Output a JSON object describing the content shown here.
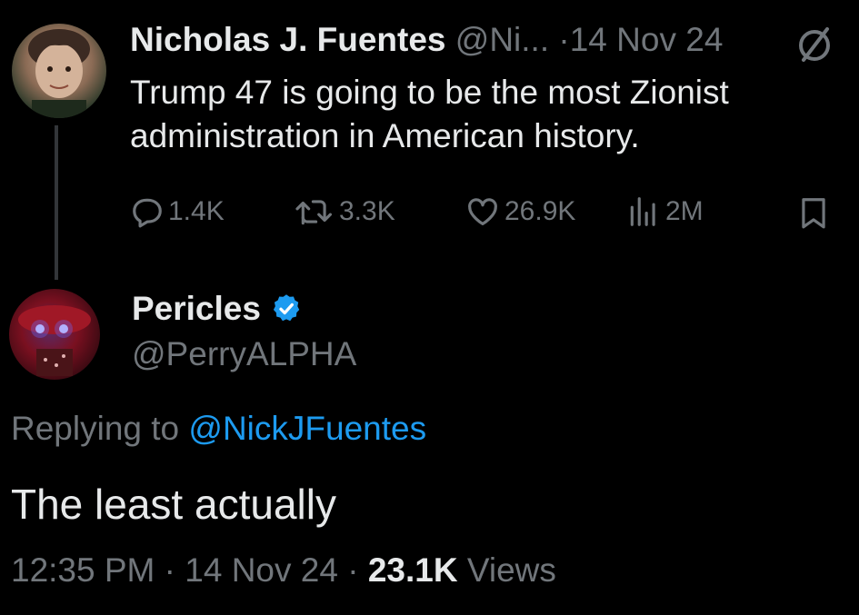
{
  "parent": {
    "name": "Nicholas J. Fuentes",
    "handle": "@Ni...",
    "separator": "·",
    "date": "14 Nov 24",
    "text": "Trump 47 is going to be the most Zionist administration in American history.",
    "stats": {
      "replies": "1.4K",
      "reposts": "3.3K",
      "likes": "26.9K",
      "views": "2M"
    }
  },
  "reply": {
    "name": "Pericles",
    "handle": "@PerryALPHA",
    "replying_prefix": "Replying to",
    "replying_to": "@NickJFuentes",
    "text": "The least actually",
    "time": "12:35 PM",
    "sep1": "·",
    "date": "14 Nov 24",
    "sep2": "·",
    "views_count": "23.1K",
    "views_label": "Views"
  },
  "colors": {
    "background": "#000000",
    "text": "#e7e9ea",
    "muted": "#71767b",
    "link": "#1d9bf0",
    "verified": "#1d9bf0"
  }
}
